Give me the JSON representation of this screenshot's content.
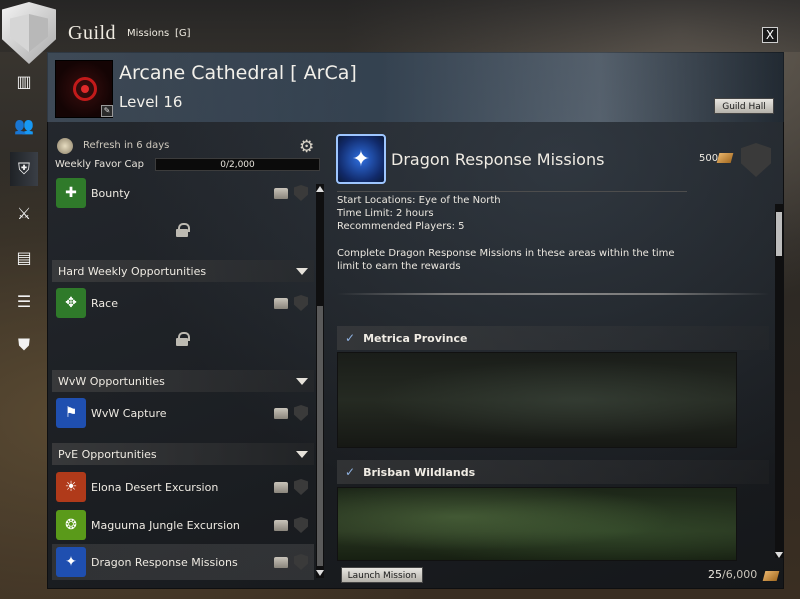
{
  "window": {
    "title": "Guild",
    "tabs": [
      {
        "label": "Missions"
      },
      {
        "label": "[G]"
      }
    ],
    "close_label": "X"
  },
  "guild": {
    "name": "Arcane Cathedral [ ArCa]",
    "level": "Level 16",
    "guild_hall_label": "Guild Hall"
  },
  "sidebar": {
    "tabs": [
      {
        "icon": "banner-icon"
      },
      {
        "icon": "roster-icon"
      },
      {
        "icon": "missions-icon",
        "active": true
      },
      {
        "icon": "crossed-swords-icon"
      },
      {
        "icon": "treasury-icon"
      },
      {
        "icon": "log-icon"
      },
      {
        "icon": "shield-icon"
      }
    ]
  },
  "missions": {
    "refresh": "Refresh in 6 days",
    "weekly_cap_label": "Weekly Favor Cap",
    "weekly_cap_value": "0/2,000",
    "list": [
      {
        "type": "row",
        "label": "Bounty",
        "icon": "bounty-icon",
        "color": "#2f7a2a"
      },
      {
        "type": "locked"
      },
      {
        "type": "section",
        "label": "Hard Weekly Opportunities"
      },
      {
        "type": "row",
        "label": "Race",
        "icon": "race-icon",
        "color": "#2f7a2a"
      },
      {
        "type": "locked"
      },
      {
        "type": "section",
        "label": "WvW Opportunities"
      },
      {
        "type": "row",
        "label": "WvW Capture",
        "icon": "wvw-capture-icon",
        "color": "#1f4fb0"
      },
      {
        "type": "section",
        "label": "PvE Opportunities"
      },
      {
        "type": "row",
        "label": "Elona Desert Excursion",
        "icon": "elona-icon",
        "color": "#b03a1a"
      },
      {
        "type": "row",
        "label": "Maguuma Jungle Excursion",
        "icon": "maguuma-icon",
        "color": "#5a9a1a"
      },
      {
        "type": "row",
        "label": "Dragon Response Missions",
        "icon": "dragon-response-icon",
        "color": "#1f4fb0",
        "selected": true
      }
    ]
  },
  "detail": {
    "title": "Dragon Response Missions",
    "favor_reward": "500",
    "start_locations": "Start Locations: Eye of the North",
    "time_limit": "Time Limit: 2 hours",
    "players": "Recommended Players: 5",
    "description": "Complete Dragon Response Missions in these areas within the time limit to earn the rewards",
    "areas": [
      {
        "name": "Metrica Province"
      },
      {
        "name": "Brisban Wildlands"
      }
    ],
    "launch_label": "Launch Mission"
  },
  "footer": {
    "favor_current": "25",
    "favor_max": "/6,000"
  }
}
